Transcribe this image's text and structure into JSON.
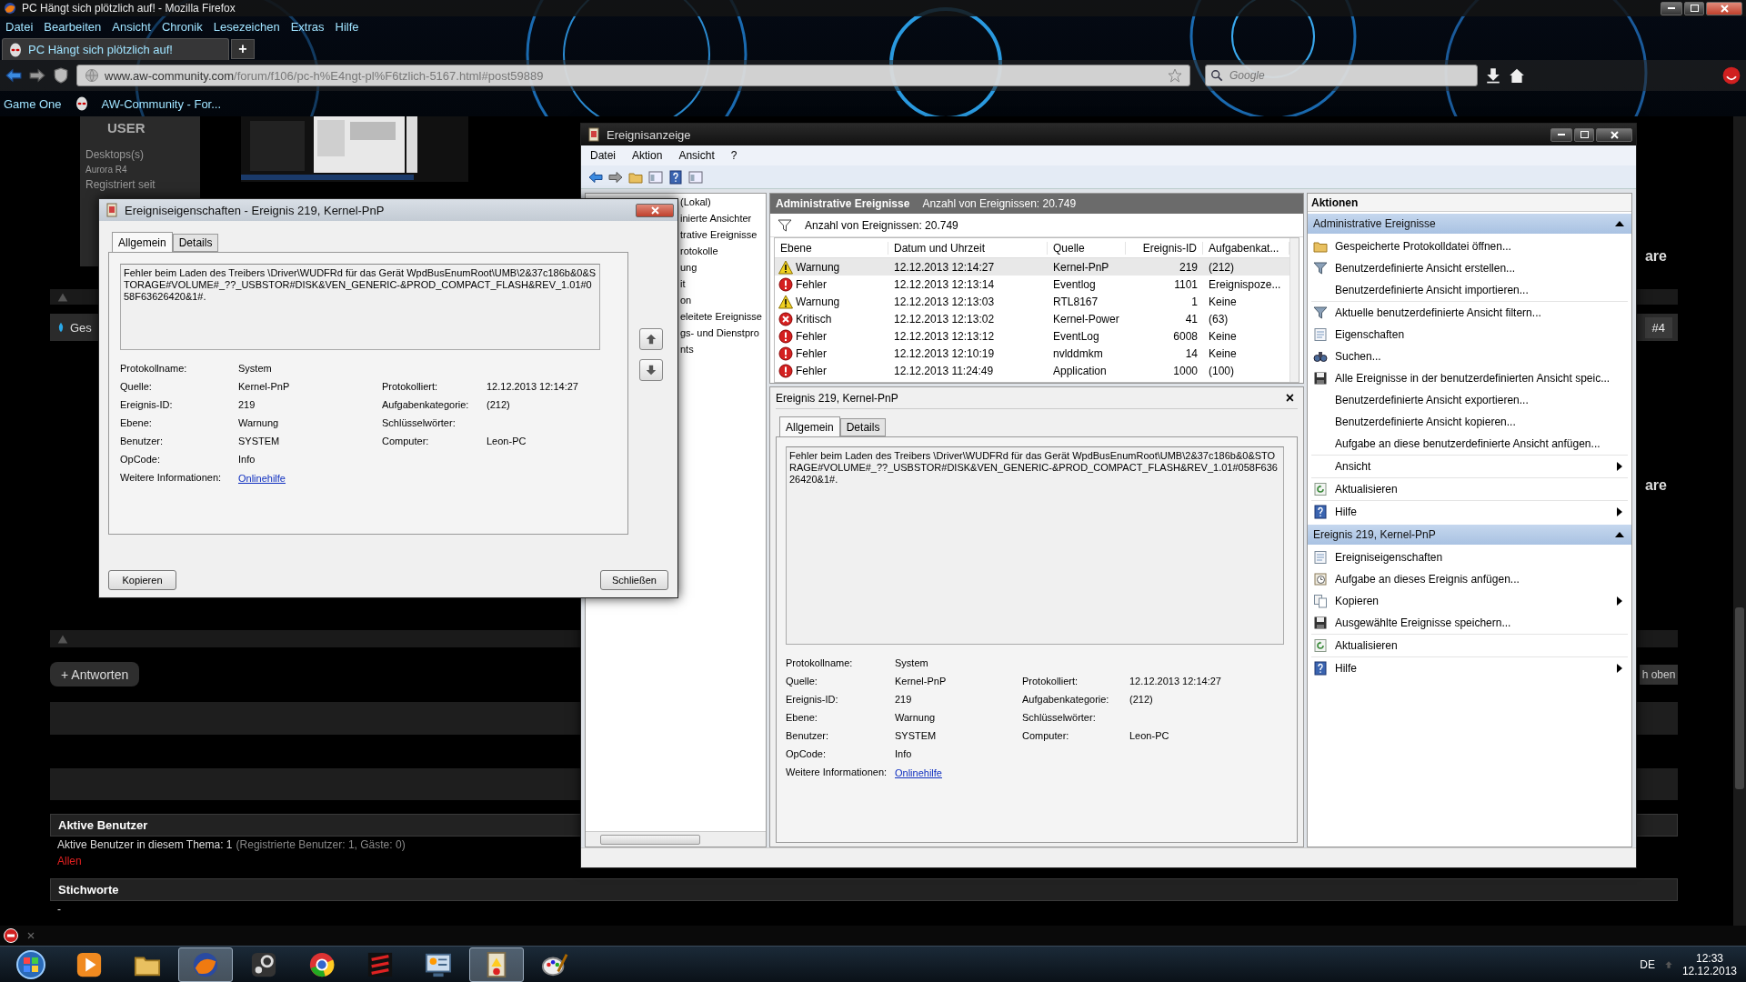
{
  "browser": {
    "title": "PC Hängt sich plötzlich auf! - Mozilla Firefox",
    "menu": [
      "Datei",
      "Bearbeiten",
      "Ansicht",
      "Chronik",
      "Lesezeichen",
      "Extras",
      "Hilfe"
    ],
    "tabs": [
      {
        "label": "PC Hängt sich plötzlich auf!",
        "selected": true
      }
    ],
    "new_tab": "+",
    "url": {
      "host": "www.aw-community.com",
      "path": "/forum/f106/pc-h%E4ngt-pl%F6tzlich-5167.html#post59889"
    },
    "search": {
      "placeholder": "Google"
    },
    "bookmarks": [
      "Game One",
      "AW-Community - For..."
    ]
  },
  "website": {
    "user_panel": {
      "heading": "USER",
      "lines": [
        "Desktops(s)",
        "Aurora R4",
        "Registriert seit"
      ]
    },
    "post_title": "Ges",
    "post_number": "#4",
    "side_texts": [
      "are",
      "are"
    ],
    "reply_button": "+ Antworten",
    "top_button": "h oben",
    "active_users": {
      "heading": "Aktive Benutzer",
      "text": "Aktive Benutzer in diesem Thema: 1",
      "detail": "(Registrierte Benutzer: 1, Gäste: 0)",
      "link": "Allen"
    },
    "tags": {
      "heading": "Stichworte",
      "text": "-"
    }
  },
  "event_viewer": {
    "title": "Ereignisanzeige",
    "menu": [
      "Datei",
      "Aktion",
      "Ansicht",
      "?"
    ],
    "tree": [
      "(Lokal)",
      "inierte Ansichter",
      "trative Ereignisse",
      "rotokolle",
      "ung",
      "it",
      "on",
      "eleitete Ereignisse",
      "gs- und Dienstpro",
      "nts"
    ],
    "list_header": {
      "title": "Administrative Ereignisse",
      "count": "Anzahl von Ereignissen: 20.749"
    },
    "filter_text": "Anzahl von Ereignissen: 20.749",
    "columns": [
      "Ebene",
      "Datum und Uhrzeit",
      "Quelle",
      "Ereignis-ID",
      "Aufgabenkat..."
    ],
    "rows": [
      {
        "kind": "warning",
        "level": "Warnung",
        "date": "12.12.2013 12:14:27",
        "source": "Kernel-PnP",
        "id": "219",
        "task": "(212)",
        "selected": true
      },
      {
        "kind": "error",
        "level": "Fehler",
        "date": "12.12.2013 12:13:14",
        "source": "Eventlog",
        "id": "1101",
        "task": "Ereignispoze...",
        "selected": false
      },
      {
        "kind": "warning",
        "level": "Warnung",
        "date": "12.12.2013 12:13:03",
        "source": "RTL8167",
        "id": "1",
        "task": "Keine",
        "selected": false
      },
      {
        "kind": "critical",
        "level": "Kritisch",
        "date": "12.12.2013 12:13:02",
        "source": "Kernel-Power",
        "id": "41",
        "task": "(63)",
        "selected": false
      },
      {
        "kind": "error",
        "level": "Fehler",
        "date": "12.12.2013 12:13:12",
        "source": "EventLog",
        "id": "6008",
        "task": "Keine",
        "selected": false
      },
      {
        "kind": "error",
        "level": "Fehler",
        "date": "12.12.2013 12:10:19",
        "source": "nvlddmkm",
        "id": "14",
        "task": "Keine",
        "selected": false
      },
      {
        "kind": "error",
        "level": "Fehler",
        "date": "12.12.2013 11:24:49",
        "source": "Application",
        "id": "1000",
        "task": "(100)",
        "selected": false
      }
    ],
    "detail": {
      "title": "Ereignis 219, Kernel-PnP",
      "close": "×",
      "tabs": [
        {
          "label": "Allgemein",
          "selected": true
        },
        {
          "label": "Details",
          "selected": false
        }
      ],
      "description": "Fehler beim Laden des Treibers \\Driver\\WUDFRd für das Gerät WpdBusEnumRoot\\UMB\\2&37c186b&0&STORAGE#VOLUME#_??_USBSTOR#DISK&VEN_GENERIC-&PROD_COMPACT_FLASH&REV_1.01#058F63626420&1#.",
      "fields": [
        {
          "left": {
            "label": "Protokollname:",
            "value": "System"
          }
        },
        {
          "left": {
            "label": "Quelle:",
            "value": "Kernel-PnP"
          },
          "right": {
            "label": "Protokolliert:",
            "value": "12.12.2013 12:14:27"
          }
        },
        {
          "left": {
            "label": "Ereignis-ID:",
            "value": "219"
          },
          "right": {
            "label": "Aufgabenkategorie:",
            "value": "(212)"
          }
        },
        {
          "left": {
            "label": "Ebene:",
            "value": "Warnung"
          },
          "right": {
            "label": "Schlüsselwörter:"
          }
        },
        {
          "left": {
            "label": "Benutzer:",
            "value": "SYSTEM"
          },
          "right": {
            "label": "Computer:",
            "value": "Leon-PC"
          }
        },
        {
          "left": {
            "label": "OpCode:",
            "value": "Info"
          }
        }
      ],
      "more_label": "Weitere Informationen:",
      "more_link": "Onlinehilfe"
    },
    "actions": {
      "title": "Aktionen",
      "sections": [
        {
          "title": "Administrative Ereignisse",
          "expanded": true,
          "groups": [
            [
              {
                "label": "Gespeicherte Protokolldatei öffnen...",
                "submenu": false
              },
              {
                "label": "Benutzerdefinierte Ansicht erstellen...",
                "submenu": false
              },
              {
                "label": "Benutzerdefinierte Ansicht importieren...",
                "submenu": false
              }
            ],
            [
              {
                "label": "Aktuelle benutzerdefinierte Ansicht filtern...",
                "submenu": false
              },
              {
                "label": "Eigenschaften",
                "submenu": false
              },
              {
                "label": "Suchen...",
                "submenu": false
              },
              {
                "label": "Alle Ereignisse in der benutzerdefinierten Ansicht speic...",
                "submenu": false
              },
              {
                "label": "Benutzerdefinierte Ansicht exportieren...",
                "submenu": false
              },
              {
                "label": "Benutzerdefinierte Ansicht kopieren...",
                "submenu": false
              },
              {
                "label": "Aufgabe an diese benutzerdefinierte Ansicht anfügen...",
                "submenu": false
              }
            ],
            [
              {
                "label": "Ansicht",
                "submenu": true
              }
            ],
            [
              {
                "label": "Aktualisieren",
                "submenu": false
              }
            ],
            [
              {
                "label": "Hilfe",
                "submenu": true
              }
            ]
          ]
        },
        {
          "title": "Ereignis 219, Kernel-PnP",
          "expanded": true,
          "groups": [
            [
              {
                "label": "Ereigniseigenschaften",
                "submenu": false
              },
              {
                "label": "Aufgabe an dieses Ereignis anfügen...",
                "submenu": false
              },
              {
                "label": "Kopieren",
                "submenu": true
              },
              {
                "label": "Ausgewählte Ereignisse speichern...",
                "submenu": false
              }
            ],
            [
              {
                "label": "Aktualisieren",
                "submenu": false
              }
            ],
            [
              {
                "label": "Hilfe",
                "submenu": true
              }
            ]
          ]
        }
      ]
    }
  },
  "dialog": {
    "title": "Ereigniseigenschaften - Ereignis 219, Kernel-PnP",
    "tabs": [
      {
        "label": "Allgemein",
        "selected": true
      },
      {
        "label": "Details",
        "selected": false
      }
    ],
    "description": "Fehler beim Laden des Treibers \\Driver\\WUDFRd für das Gerät WpdBusEnumRoot\\UMB\\2&37c186b&0&STORAGE#VOLUME#_??_USBSTOR#DISK&VEN_GENERIC-&PROD_COMPACT_FLASH&REV_1.01#058F63626420&1#.",
    "fields": [
      {
        "left": {
          "label": "Protokollname:",
          "value": "System"
        }
      },
      {
        "left": {
          "label": "Quelle:",
          "value": "Kernel-PnP"
        },
        "right": {
          "label": "Protokolliert:",
          "value": "12.12.2013 12:14:27"
        }
      },
      {
        "left": {
          "label": "Ereignis-ID:",
          "value": "219"
        },
        "right": {
          "label": "Aufgabenkategorie:",
          "value": "(212)"
        }
      },
      {
        "left": {
          "label": "Ebene:",
          "value": "Warnung"
        },
        "right": {
          "label": "Schlüsselwörter:"
        }
      },
      {
        "left": {
          "label": "Benutzer:",
          "value": "SYSTEM"
        },
        "right": {
          "label": "Computer:",
          "value": "Leon-PC"
        }
      },
      {
        "left": {
          "label": "OpCode:",
          "value": "Info"
        }
      }
    ],
    "more_label": "Weitere Informationen:",
    "more_link": "Onlinehilfe",
    "buttons": [
      "Kopieren",
      "Schließen"
    ]
  },
  "taskbar": {
    "apps": [
      {
        "kind": "media",
        "selected": false
      },
      {
        "kind": "folder",
        "selected": false
      },
      {
        "kind": "browser",
        "selected": true
      },
      {
        "kind": "steam",
        "selected": false
      },
      {
        "kind": "chrome",
        "selected": false
      },
      {
        "kind": "game",
        "selected": false
      },
      {
        "kind": "system",
        "selected": false
      },
      {
        "kind": "events",
        "selected": true
      },
      {
        "kind": "paint",
        "selected": false
      }
    ],
    "language": "DE",
    "time": "12:33",
    "date": "12.12.2013"
  }
}
